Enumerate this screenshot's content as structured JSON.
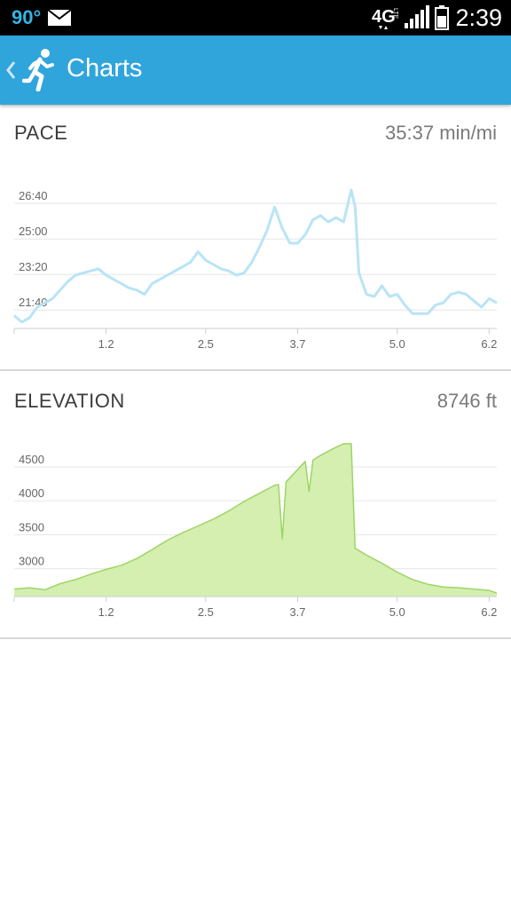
{
  "status_bar": {
    "temperature": "90°",
    "network": "4G",
    "network_sub": "LTE",
    "time": "2:39",
    "icons": [
      "mail-icon",
      "network-4g-lte-icon",
      "signal-icon",
      "battery-icon"
    ]
  },
  "app_bar": {
    "back_icon": "chevron-left-icon",
    "logo_icon": "runner-icon",
    "title": "Charts"
  },
  "colors": {
    "status_bar": "#000000",
    "accent": "#2fa5dc",
    "pace_line": "#b8e4f6",
    "elevation_fill": "#d4efb0",
    "elevation_line": "#9ed565",
    "divider": "#d7d7d7"
  },
  "pace": {
    "title": "PACE",
    "value": "35:37 min/mi"
  },
  "elevation": {
    "title": "ELEVATION",
    "value": "8746 ft"
  },
  "chart_data": [
    {
      "type": "line",
      "title": "PACE",
      "x_ticks": [
        "1.2",
        "2.5",
        "3.7",
        "5.0",
        "6.2"
      ],
      "y_ticks": [
        "26:40",
        "25:00",
        "23:20",
        "21:40"
      ],
      "y_tick_values_min": [
        26.667,
        25.0,
        23.333,
        21.667
      ],
      "xlim": [
        0,
        6.3
      ],
      "ylim": [
        20.8,
        28.3
      ],
      "grid": true,
      "series": [
        {
          "x": [
            0.0,
            0.1,
            0.2,
            0.3,
            0.4,
            0.5,
            0.6,
            0.7,
            0.8,
            0.9,
            1.0,
            1.1,
            1.2,
            1.3,
            1.4,
            1.5,
            1.6,
            1.7,
            1.8,
            1.9,
            2.0,
            2.1,
            2.2,
            2.3,
            2.4,
            2.5,
            2.6,
            2.7,
            2.8,
            2.9,
            3.0,
            3.1,
            3.2,
            3.3,
            3.4,
            3.5,
            3.6,
            3.7,
            3.8,
            3.9,
            4.0,
            4.1,
            4.2,
            4.3,
            4.4,
            4.45,
            4.5,
            4.6,
            4.7,
            4.8,
            4.9,
            5.0,
            5.1,
            5.2,
            5.3,
            5.4,
            5.5,
            5.6,
            5.7,
            5.8,
            5.9,
            6.0,
            6.1,
            6.2,
            6.3
          ],
          "y": [
            21.4,
            21.1,
            21.3,
            21.8,
            22.0,
            22.2,
            22.6,
            23.0,
            23.3,
            23.4,
            23.5,
            23.6,
            23.3,
            23.1,
            22.9,
            22.7,
            22.6,
            22.4,
            22.9,
            23.1,
            23.3,
            23.5,
            23.7,
            23.9,
            24.4,
            24.0,
            23.8,
            23.6,
            23.5,
            23.3,
            23.4,
            23.9,
            24.6,
            25.4,
            26.5,
            25.5,
            24.8,
            24.8,
            25.2,
            25.9,
            26.1,
            25.8,
            26.0,
            25.8,
            27.3,
            26.5,
            23.4,
            22.4,
            22.3,
            22.8,
            22.3,
            22.4,
            21.9,
            21.5,
            21.5,
            21.5,
            21.9,
            22.0,
            22.4,
            22.5,
            22.4,
            22.1,
            21.8,
            22.2,
            22.0
          ]
        }
      ]
    },
    {
      "type": "area",
      "title": "ELEVATION",
      "x_ticks": [
        "1.2",
        "2.5",
        "3.7",
        "5.0",
        "6.2"
      ],
      "y_ticks": [
        "4500",
        "4000",
        "3500",
        "3000"
      ],
      "xlim": [
        0,
        6.3
      ],
      "ylim": [
        2590,
        4970
      ],
      "grid": true,
      "series": [
        {
          "x": [
            0.0,
            0.2,
            0.4,
            0.6,
            0.8,
            1.0,
            1.2,
            1.4,
            1.6,
            1.8,
            2.0,
            2.2,
            2.4,
            2.6,
            2.8,
            3.0,
            3.2,
            3.4,
            3.45,
            3.5,
            3.55,
            3.8,
            3.85,
            3.9,
            4.0,
            4.2,
            4.3,
            4.4,
            4.45,
            4.6,
            4.8,
            5.0,
            5.2,
            5.4,
            5.6,
            5.8,
            6.0,
            6.2,
            6.3
          ],
          "y": [
            2700,
            2720,
            2690,
            2780,
            2840,
            2920,
            2990,
            3050,
            3150,
            3280,
            3420,
            3530,
            3630,
            3730,
            3850,
            3990,
            4110,
            4230,
            4240,
            3440,
            4280,
            4580,
            4140,
            4600,
            4670,
            4790,
            4840,
            4840,
            3300,
            3200,
            3080,
            2950,
            2840,
            2770,
            2730,
            2720,
            2700,
            2680,
            2640
          ]
        }
      ]
    }
  ]
}
